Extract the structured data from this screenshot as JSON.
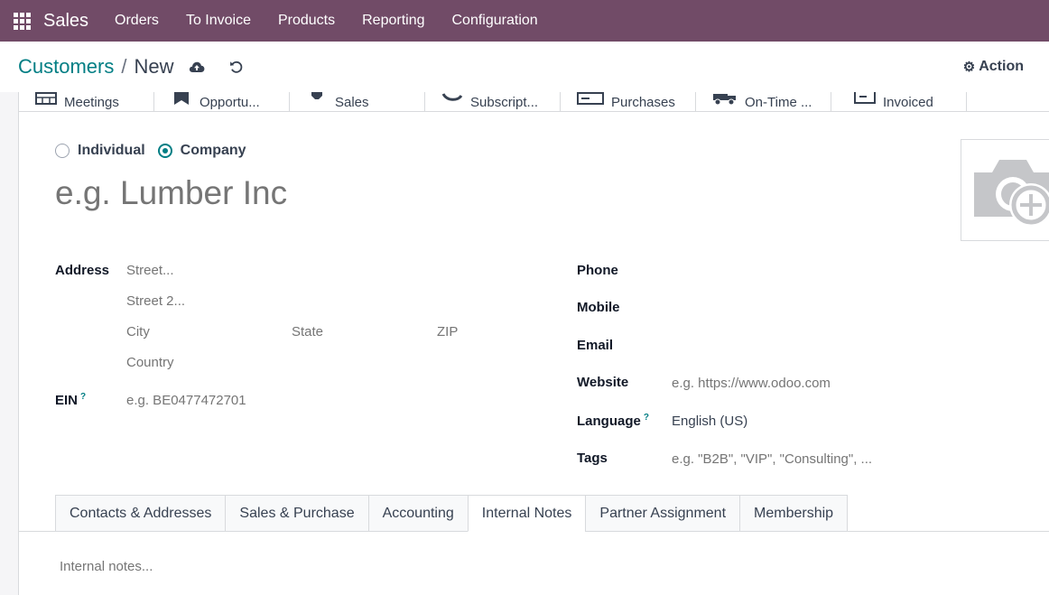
{
  "navbar": {
    "app_name": "Sales",
    "menu": [
      "Orders",
      "To Invoice",
      "Products",
      "Reporting",
      "Configuration"
    ],
    "bg_color": "#714b67"
  },
  "control_panel": {
    "breadcrumb_parent": "Customers",
    "breadcrumb_sep": "/",
    "breadcrumb_current": "New",
    "save_icon": "cloud-upload-icon",
    "discard_icon": "undo-icon",
    "action_label": "Action"
  },
  "smart_buttons": [
    {
      "label": "Meetings",
      "icon": "calendar-icon"
    },
    {
      "label": "Opportu...",
      "icon": "star-icon"
    },
    {
      "label": "Sales",
      "icon": "dollar-icon"
    },
    {
      "label": "Subscript...",
      "icon": "refresh-icon"
    },
    {
      "label": "Purchases",
      "icon": "credit-card-icon"
    },
    {
      "label": "On-Time ...",
      "icon": "truck-icon"
    },
    {
      "label": "Invoiced",
      "icon": "invoice-icon"
    }
  ],
  "company_type": {
    "individual_label": "Individual",
    "company_label": "Company",
    "selected": "Company"
  },
  "name_placeholder": "e.g. Lumber Inc",
  "left_fields": {
    "address_label": "Address",
    "street_placeholder": "Street...",
    "street2_placeholder": "Street 2...",
    "city_placeholder": "City",
    "state_placeholder": "State",
    "zip_placeholder": "ZIP",
    "country_placeholder": "Country",
    "ein_label": "EIN",
    "ein_help": "?",
    "ein_placeholder": "e.g. BE0477472701"
  },
  "right_fields": {
    "phone_label": "Phone",
    "mobile_label": "Mobile",
    "email_label": "Email",
    "website_label": "Website",
    "website_placeholder": "e.g. https://www.odoo.com",
    "language_label": "Language",
    "language_help": "?",
    "language_value": "English (US)",
    "tags_label": "Tags",
    "tags_placeholder": "e.g. \"B2B\", \"VIP\", \"Consulting\", ..."
  },
  "tabs": [
    {
      "label": "Contacts & Addresses",
      "active": false
    },
    {
      "label": "Sales & Purchase",
      "active": false
    },
    {
      "label": "Accounting",
      "active": false
    },
    {
      "label": "Internal Notes",
      "active": true
    },
    {
      "label": "Partner Assignment",
      "active": false
    },
    {
      "label": "Membership",
      "active": false
    }
  ],
  "notes_placeholder": "Internal notes...",
  "accent_color": "#017e84"
}
